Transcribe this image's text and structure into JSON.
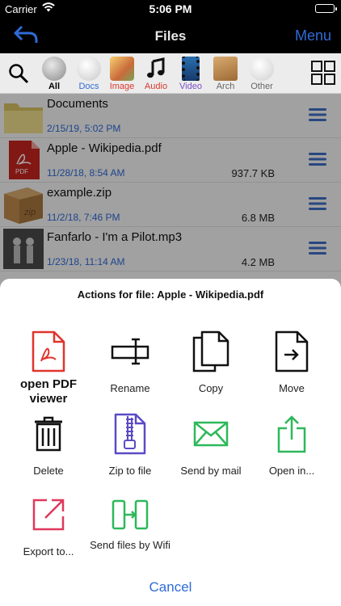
{
  "status": {
    "carrier": "Carrier",
    "time": "5:06 PM",
    "battery_level": 1.0
  },
  "nav": {
    "title": "Files",
    "menu_label": "Menu",
    "back_icon": "back-arrow-icon"
  },
  "filters": [
    {
      "label": "All",
      "icon": "all-circle-icon",
      "color": "#000000"
    },
    {
      "label": "Docs",
      "icon": "docs-icon",
      "color": "#2f6bd8"
    },
    {
      "label": "Image",
      "icon": "image-icon",
      "color": "#d8382f"
    },
    {
      "label": "Audio",
      "icon": "music-note-icon",
      "color": "#d8382f"
    },
    {
      "label": "Video",
      "icon": "film-icon",
      "color": "#7b4fc8"
    },
    {
      "label": "Arch",
      "icon": "box-icon",
      "color": "#666666"
    },
    {
      "label": "Other",
      "icon": "other-circle-icon",
      "color": "#666666"
    }
  ],
  "files": [
    {
      "name": "Documents",
      "date": "2/15/19, 5:02 PM",
      "size": "",
      "type": "folder"
    },
    {
      "name": "Apple - Wikipedia.pdf",
      "date": "11/28/18, 8:54 AM",
      "size": "937.7 KB",
      "type": "pdf"
    },
    {
      "name": "example.zip",
      "date": "11/2/18, 7:46 PM",
      "size": "6.8 MB",
      "type": "zip"
    },
    {
      "name": "Fanfarlo - I'm a Pilot.mp3",
      "date": "1/23/18, 11:14 AM",
      "size": "4.2 MB",
      "type": "mp3"
    }
  ],
  "sheet": {
    "heading": "Actions for file: Apple - Wikipedia.pdf",
    "actions": [
      {
        "label": "open PDF viewer",
        "icon": "pdf-file-icon"
      },
      {
        "label": "Rename",
        "icon": "rename-cursor-icon"
      },
      {
        "label": "Copy",
        "icon": "copy-icon"
      },
      {
        "label": "Move",
        "icon": "move-file-icon"
      },
      {
        "label": "Delete",
        "icon": "trash-icon"
      },
      {
        "label": "Zip to file",
        "icon": "zip-file-icon"
      },
      {
        "label": "Send by mail",
        "icon": "mail-icon"
      },
      {
        "label": "Open in...",
        "icon": "share-icon"
      },
      {
        "label": "Export to...",
        "icon": "export-icon"
      },
      {
        "label": "Send files by Wifi",
        "icon": "wifi-transfer-icon"
      }
    ],
    "cancel_label": "Cancel"
  },
  "colors": {
    "accent": "#2f6bd8",
    "pdf_red": "#e0342c",
    "green": "#2db85a",
    "purple": "#5a4bc6",
    "pink": "#e0385c"
  }
}
